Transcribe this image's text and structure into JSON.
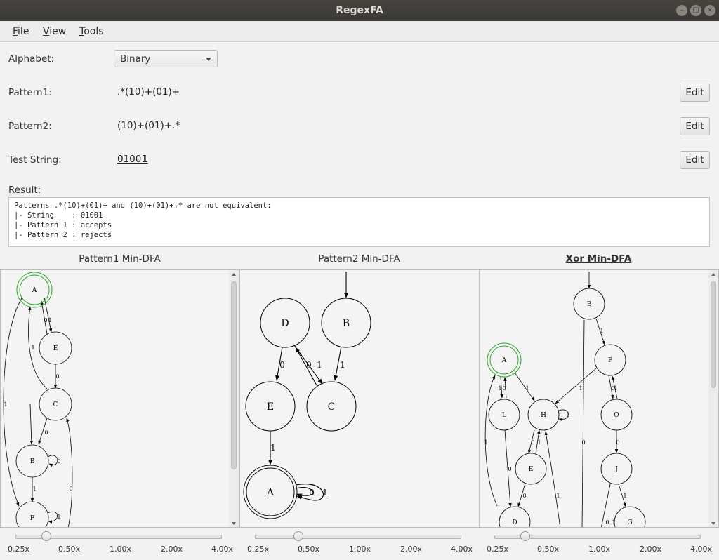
{
  "window": {
    "title": "RegexFA"
  },
  "menu": [
    "File",
    "View",
    "Tools"
  ],
  "form": {
    "alphabet_label": "Alphabet:",
    "alphabet_value": "Binary",
    "pattern1_label": "Pattern1:",
    "pattern1_value": ".*(10)+(01)+",
    "pattern2_label": "Pattern2:",
    "pattern2_value": "(10)+(01)+.*",
    "test_label": "Test String:",
    "test_value_prefix": "0100",
    "test_value_highlight": "1",
    "edit_label": "Edit",
    "result_label": "Result:"
  },
  "result_lines": [
    "Patterns .*(10)+(01)+ and (10)+(01)+.* are not equivalent:",
    "|- String    : 01001",
    "|- Pattern 1 : accepts",
    "|- Pattern 2 : rejects"
  ],
  "panels": {
    "p1_title": "Pattern1 Min-DFA",
    "p2_title": "Pattern2 Min-DFA",
    "p3_title": "Xor Min-DFA"
  },
  "zoom": {
    "ticks": [
      "0.25x",
      "0.50x",
      "1.00x",
      "2.00x",
      "4.00x"
    ],
    "levels": [
      0.5,
      0.75,
      0.5
    ]
  },
  "graphs": {
    "p1": {
      "states": [
        "A",
        "E",
        "C",
        "B",
        "F"
      ],
      "edge_labels": [
        "0",
        "1",
        "0",
        "1",
        "0",
        "0",
        "1",
        "1",
        "1",
        "0"
      ]
    },
    "p2": {
      "states": [
        "D",
        "B",
        "E",
        "C",
        "A"
      ],
      "edge_labels": [
        "0",
        "0",
        "1",
        "1",
        "1",
        "0",
        "1"
      ]
    },
    "p3": {
      "states": [
        "B",
        "A",
        "P",
        "L",
        "H",
        "O",
        "E",
        "J",
        "D",
        "G"
      ],
      "edge_labels": [
        "1",
        "1",
        "0",
        "1",
        "1",
        "0",
        "1",
        "0",
        "1",
        "0",
        "1",
        "0",
        "1",
        "0",
        "1",
        "0",
        "1",
        "1",
        "0"
      ]
    }
  }
}
